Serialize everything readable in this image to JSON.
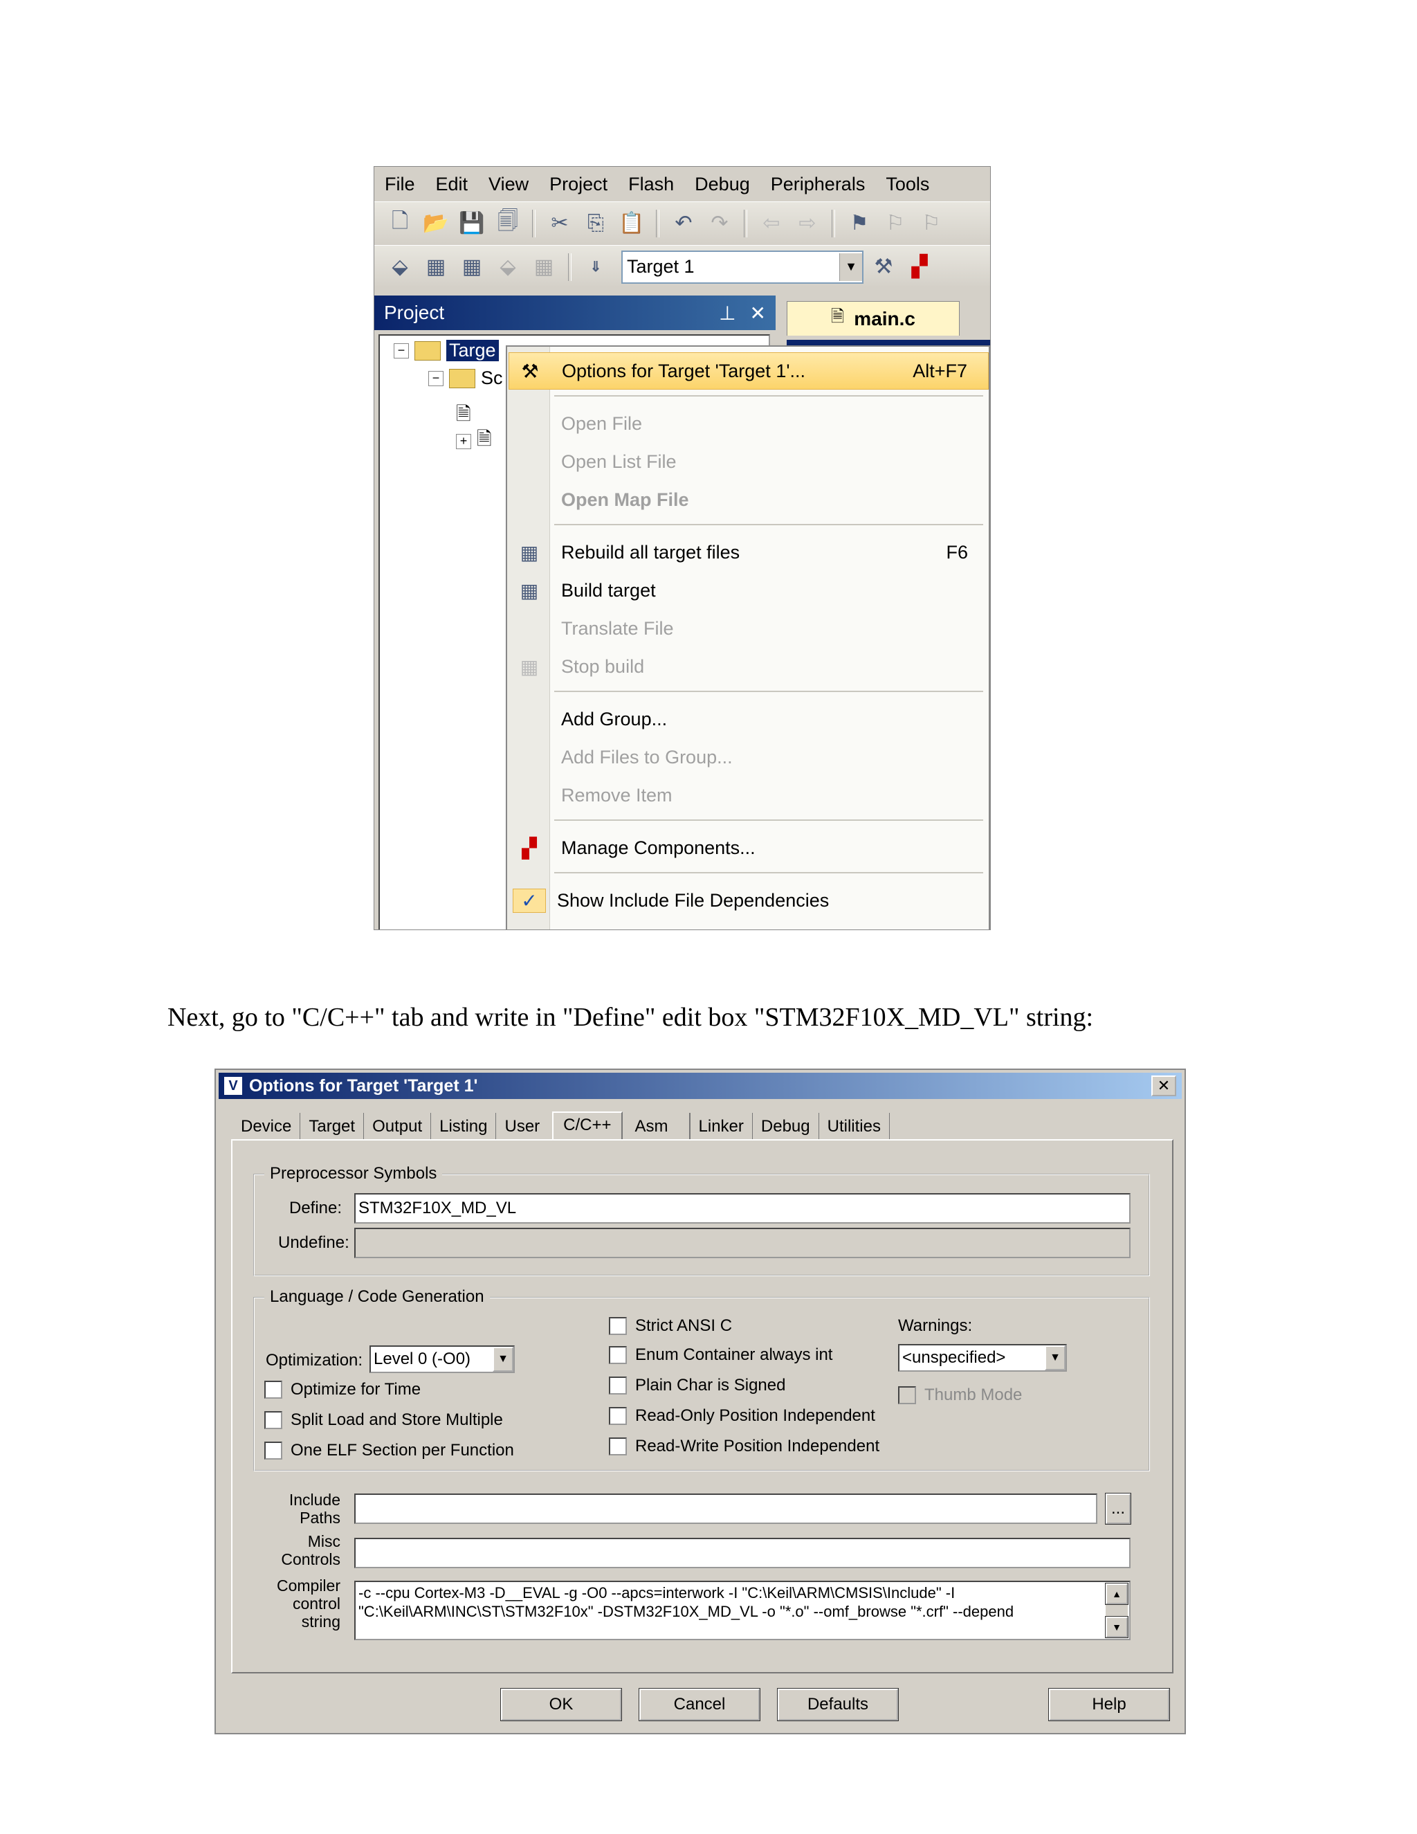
{
  "ide": {
    "menu": [
      "File",
      "Edit",
      "View",
      "Project",
      "Flash",
      "Debug",
      "Peripherals",
      "Tools"
    ],
    "target_select": "Target 1",
    "project_panel": {
      "title": "Project",
      "pin": "ᵖ",
      "close": "✕"
    },
    "editor_tab": "main.c",
    "tree": {
      "root": "Targe",
      "group": "Sc"
    },
    "context_menu": {
      "options_target": {
        "label": "Options for Target 'Target 1'...",
        "shortcut": "Alt+F7"
      },
      "open_file": "Open File",
      "open_list_file": "Open List File",
      "open_map_file": "Open Map File",
      "rebuild_all": {
        "label": "Rebuild all target files",
        "shortcut": "F6"
      },
      "build_target": "Build target",
      "translate_file": "Translate File",
      "stop_build": "Stop build",
      "add_group": "Add Group...",
      "add_files": "Add Files to Group...",
      "remove_item": "Remove Item",
      "manage_components": "Manage Components...",
      "show_include": "Show Include File Dependencies"
    }
  },
  "caption": "Next, go to \"C/C++\" tab and write in \"Define\" edit box \"STM32F10X_MD_VL\" string:",
  "dialog": {
    "title": "Options for Target 'Target 1'",
    "tabs": [
      "Device",
      "Target",
      "Output",
      "Listing",
      "User",
      "C/C++",
      "Asm",
      "Linker",
      "Debug",
      "Utilities"
    ],
    "active_tab": "C/C++",
    "preprocessor": {
      "title": "Preprocessor Symbols",
      "define_label": "Define:",
      "define_value": "STM32F10X_MD_VL",
      "undefine_label": "Undefine:",
      "undefine_value": ""
    },
    "language": {
      "title": "Language / Code Generation",
      "optimization_label": "Optimization:",
      "optimization_value": "Level 0 (-O0)",
      "optimize_time": "Optimize for Time",
      "split_load": "Split Load and Store Multiple",
      "one_elf": "One ELF Section per Function",
      "strict_ansi": "Strict ANSI C",
      "enum_container": "Enum Container always int",
      "plain_char": "Plain Char is Signed",
      "ro_pi": "Read-Only Position Independent",
      "rw_pi": "Read-Write Position Independent",
      "warnings_label": "Warnings:",
      "warnings_value": "<unspecified>",
      "thumb_mode": "Thumb Mode"
    },
    "include_paths_label": [
      "Include",
      "Paths"
    ],
    "include_paths_value": "",
    "browse_label": "...",
    "misc_controls_label": [
      "Misc",
      "Controls"
    ],
    "misc_controls_value": "",
    "compiler_string_label": [
      "Compiler",
      "control",
      "string"
    ],
    "compiler_string_lines": [
      "-c --cpu Cortex-M3 -D__EVAL -g -O0 --apcs=interwork -I \"C:\\Keil\\ARM\\CMSIS\\Include\" -I",
      "\"C:\\Keil\\ARM\\INC\\ST\\STM32F10x\" -DSTM32F10X_MD_VL -o \"*.o\" --omf_browse \"*.crf\" --depend"
    ],
    "buttons": {
      "ok": "OK",
      "cancel": "Cancel",
      "defaults": "Defaults",
      "help": "Help"
    }
  }
}
